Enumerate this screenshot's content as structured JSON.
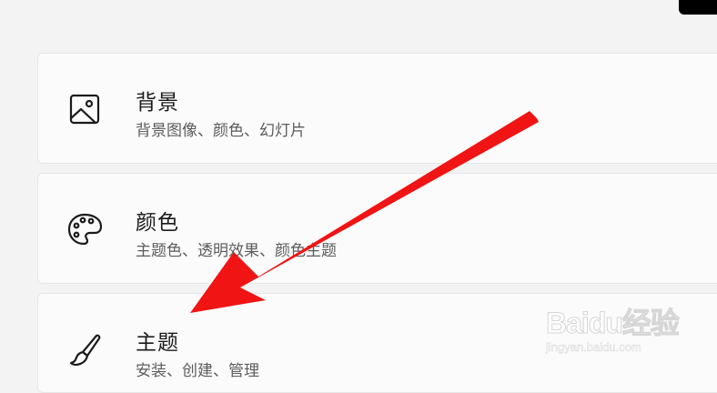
{
  "settings": {
    "items": [
      {
        "title": "背景",
        "subtitle": "背景图像、颜色、幻灯片",
        "icon": "image-icon"
      },
      {
        "title": "颜色",
        "subtitle": "主题色、透明效果、颜色主题",
        "icon": "palette-icon"
      },
      {
        "title": "主题",
        "subtitle": "安装、创建、管理",
        "icon": "paintbrush-icon"
      }
    ]
  },
  "annotation": {
    "arrow_color": "#f01414"
  },
  "watermark": {
    "logo": "Baidu经验",
    "url": "jingyan.baidu.com"
  }
}
